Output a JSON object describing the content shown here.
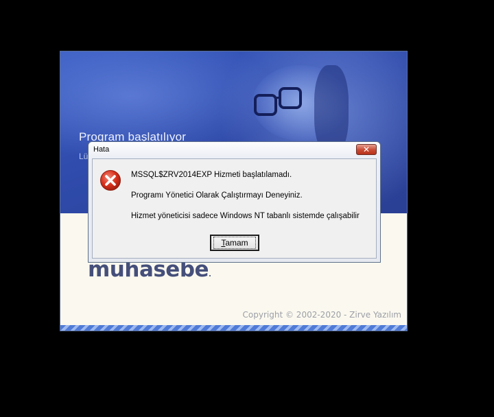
{
  "splash": {
    "status_text": "Program başlatılıyor",
    "status_subtext": "Lü",
    "brand": "muhasebe",
    "brand_mark": ".",
    "copyright": "Copyright © 2002-2020 - Zirve Yazılım"
  },
  "dialog": {
    "title": "Hata",
    "close_glyph": "✕",
    "icon": "error-icon",
    "messages": [
      "MSSQL$ZRV2014EXP Hizmeti başlatılamadı.",
      "Programı Yönetici Olarak Çalıştırmayı Deneyiniz.",
      "Hizmet yöneticisi sadece Windows NT tabanlı sistemde çalışabilir"
    ],
    "ok_button": {
      "mnemonic": "T",
      "rest": "amam"
    }
  },
  "colors": {
    "hero_blue": "#3c5fc4",
    "brand_text": "#454f7a",
    "error_red": "#d9321e"
  }
}
